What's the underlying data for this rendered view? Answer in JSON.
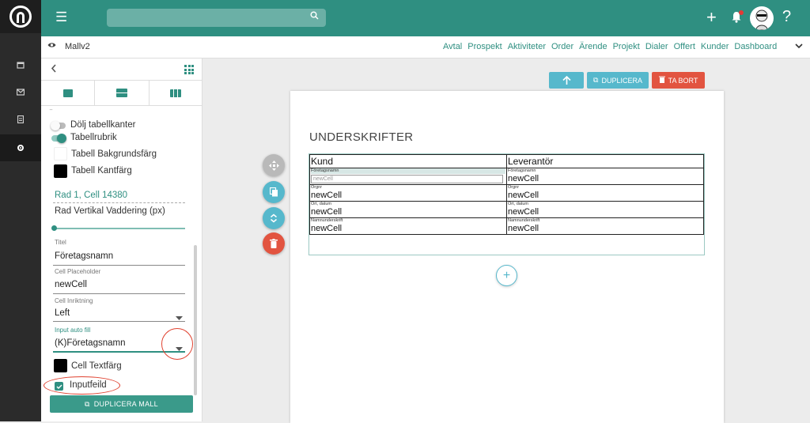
{
  "header": {
    "search_placeholder": "",
    "plus_label": "+",
    "help_label": "?"
  },
  "subbar": {
    "template_name": "Mallv2",
    "nav_links": [
      "Avtal",
      "Prospekt",
      "Aktiviteter",
      "Order",
      "Ärende",
      "Projekt",
      "Dialer",
      "Offert",
      "Kunder",
      "Dashboard"
    ]
  },
  "panel": {
    "hide_borders_label": "Dölj tabellkanter",
    "table_header_label": "Tabellrubrik",
    "bg_color_label": "Tabell Bakgrundsfärg",
    "border_color_label": "Tabell Kantfärg",
    "cell_ref": "Rad 1, Cell 14380",
    "padding_label": "Rad Vertikal Vaddering (px)",
    "padding_value": 0,
    "title_label": "Titel",
    "title_value": "Företagsnamn",
    "placeholder_label": "Cell Placeholder",
    "placeholder_value": "newCell",
    "align_label": "Cell Inriktning",
    "align_value": "Left",
    "autofill_label": "Input auto fill",
    "autofill_value": "(K)Företagsnamn",
    "text_color_label": "Cell Textfärg",
    "input_field_label": "Inputfeild",
    "input_field_checked": true,
    "duplicate_template_label": "DUPLICERA MALL",
    "colors": {
      "bg": "#ffffff",
      "border": "#000000",
      "text": "#000000"
    }
  },
  "toolbar": {
    "duplicate_label": "DUPLICERA",
    "delete_label": "TA BORT"
  },
  "document": {
    "section_title": "UNDERSKRIFTER",
    "table": {
      "headers": [
        "Kund",
        "Leverantör"
      ],
      "rows": [
        [
          {
            "title": "Företagsnamn",
            "value": "newCell",
            "is_input": true
          },
          {
            "title": "Företagsnamn",
            "value": "newCell"
          }
        ],
        [
          {
            "title": "Orgnr",
            "value": "newCell"
          },
          {
            "title": "Orgnr",
            "value": "newCell"
          }
        ],
        [
          {
            "title": "Ort, datum",
            "value": "newCell"
          },
          {
            "title": "Ort, datum",
            "value": "newCell"
          }
        ],
        [
          {
            "title": "Namnunderskrift",
            "value": "newCell"
          },
          {
            "title": "Namnunderskrift",
            "value": "newCell"
          }
        ]
      ]
    }
  },
  "icons": {
    "rail": [
      "calendar-icon",
      "mail-icon",
      "document-icon",
      "settings-icon"
    ],
    "fabs": [
      "move-icon",
      "copy-icon",
      "expand-icon",
      "trash-icon"
    ]
  },
  "theme": {
    "primary": "#2f8f81",
    "accent": "#56b8cc",
    "danger": "#e25440"
  }
}
